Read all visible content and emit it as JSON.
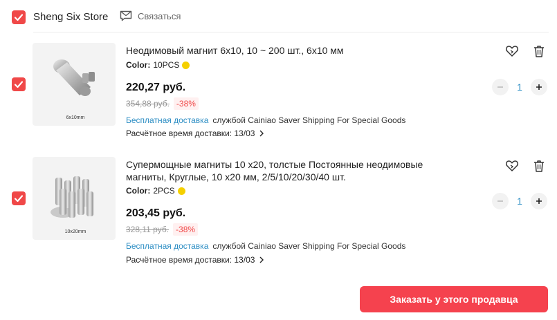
{
  "store": {
    "name": "Sheng Six Store",
    "contact_label": "Связаться"
  },
  "items": [
    {
      "title": "Неодимовый магнит 6x10, 10 ~ 200 шт., 6x10 мм",
      "color_key": "Color:",
      "color_value": "10PCS",
      "price": "220,27 руб.",
      "old_price": "354,88 руб.",
      "discount": "-38%",
      "shipping_free": "Бесплатная доставка",
      "shipping_by": "службой Cainiao Saver Shipping For Special Goods",
      "delivery": "Расчётное время доставки: 13/03",
      "quantity": "1",
      "image_caption": "6x10mm"
    },
    {
      "title": "Супермощные магниты 10 x20, толстые Постоянные неодимовые магниты, Круглые, 10 x20 мм, 2/5/10/20/30/40 шт.",
      "color_key": "Color:",
      "color_value": "2PCS",
      "price": "203,45 руб.",
      "old_price": "328,11 руб.",
      "discount": "-38%",
      "shipping_free": "Бесплатная доставка",
      "shipping_by": "службой Cainiao Saver Shipping For Special Goods",
      "delivery": "Расчётное время доставки: 13/03",
      "quantity": "1",
      "image_caption": "10x20mm"
    }
  ],
  "order_button_label": "Заказать у этого продавца",
  "colors": {
    "accent_red": "#f04848",
    "link_blue": "#2d8ec4",
    "order_button": "#f5424e",
    "color_dot": "#f5d000"
  },
  "icons": [
    "check-icon",
    "chat-icon",
    "wishlist-icon",
    "trash-icon",
    "minus-icon",
    "plus-icon",
    "chevron-right-icon"
  ]
}
